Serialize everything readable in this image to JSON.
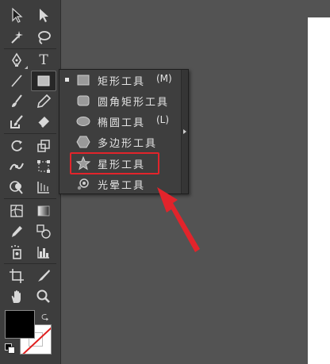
{
  "toolbar": {
    "type_tool_glyph": "T",
    "tools": [
      {
        "name": "selection-tool",
        "icon": "arrow-icon"
      },
      {
        "name": "direct-selection-tool",
        "icon": "hollow-arrow-icon"
      },
      {
        "name": "magic-wand-tool",
        "icon": "magic-wand-icon"
      },
      {
        "name": "lasso-tool",
        "icon": "lasso-icon"
      },
      {
        "name": "pen-tool",
        "icon": "pen-icon"
      },
      {
        "name": "type-tool",
        "icon": "type-icon"
      },
      {
        "name": "line-tool",
        "icon": "line-icon"
      },
      {
        "name": "rectangle-tool",
        "icon": "rectangle-icon"
      },
      {
        "name": "paintbrush-tool",
        "icon": "brush-icon"
      },
      {
        "name": "pencil-tool",
        "icon": "pencil-icon"
      },
      {
        "name": "blob-brush-tool",
        "icon": "blob-brush-icon"
      },
      {
        "name": "eraser-tool",
        "icon": "eraser-icon"
      },
      {
        "name": "rotate-tool",
        "icon": "rotate-icon"
      },
      {
        "name": "scale-tool",
        "icon": "scale-icon"
      },
      {
        "name": "width-tool",
        "icon": "width-icon"
      },
      {
        "name": "free-transform-tool",
        "icon": "free-transform-icon"
      },
      {
        "name": "shape-builder-tool",
        "icon": "shape-builder-icon"
      },
      {
        "name": "perspective-grid-tool",
        "icon": "perspective-grid-icon"
      },
      {
        "name": "mesh-tool",
        "icon": "mesh-icon"
      },
      {
        "name": "gradient-tool",
        "icon": "gradient-icon"
      },
      {
        "name": "eyedropper-tool",
        "icon": "eyedropper-icon"
      },
      {
        "name": "blend-tool",
        "icon": "blend-icon"
      },
      {
        "name": "symbol-sprayer-tool",
        "icon": "symbol-sprayer-icon"
      },
      {
        "name": "column-graph-tool",
        "icon": "column-graph-icon"
      },
      {
        "name": "artboard-tool",
        "icon": "artboard-icon"
      },
      {
        "name": "slice-tool",
        "icon": "slice-icon"
      },
      {
        "name": "hand-tool",
        "icon": "hand-icon"
      },
      {
        "name": "zoom-tool",
        "icon": "zoom-icon"
      }
    ],
    "fill_color": "#000000",
    "stroke_color": "none"
  },
  "flyout": {
    "items": [
      {
        "label": "矩形工具",
        "shortcut": "(M)",
        "icon": "rectangle-icon",
        "selected": true
      },
      {
        "label": "圆角矩形工具",
        "shortcut": "",
        "icon": "rounded-rectangle-icon",
        "selected": false
      },
      {
        "label": "椭圆工具",
        "shortcut": "(L)",
        "icon": "ellipse-icon",
        "selected": false
      },
      {
        "label": "多边形工具",
        "shortcut": "",
        "icon": "polygon-icon",
        "selected": false
      },
      {
        "label": "星形工具",
        "shortcut": "",
        "icon": "star-icon",
        "selected": false
      },
      {
        "label": "光晕工具",
        "shortcut": "",
        "icon": "flare-icon",
        "selected": false
      }
    ],
    "highlighted_item": "星形工具"
  },
  "colors": {
    "toolbar_bg": "#3d3d3d",
    "canvas_bg": "#535353",
    "annotation_red": "#e2242b",
    "artboard": "#ffffff"
  }
}
